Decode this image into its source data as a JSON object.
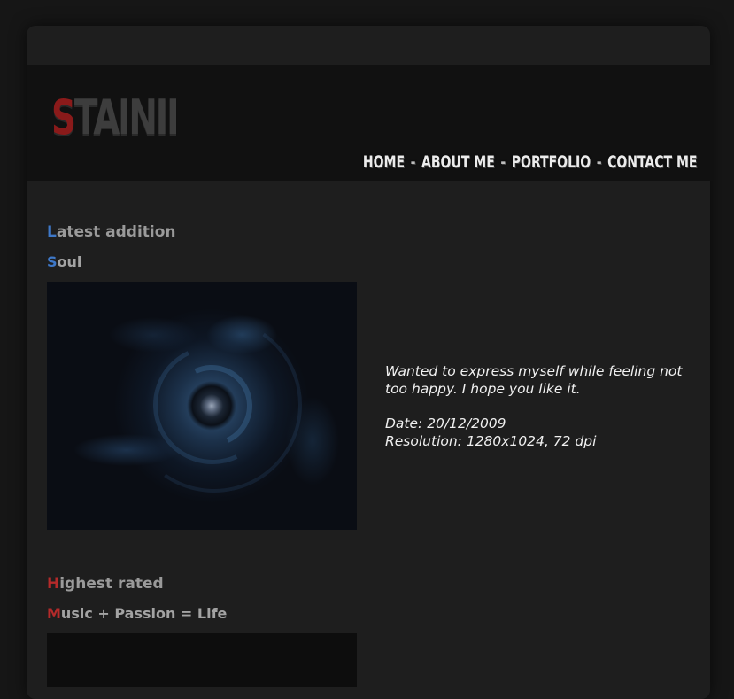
{
  "header": {
    "logo_first_letter": "S",
    "logo_rest": "TAINII",
    "nav": [
      {
        "label": "HOME"
      },
      {
        "label": "ABOUT ME"
      },
      {
        "label": "PORTFOLIO"
      },
      {
        "label": "CONTACT ME"
      }
    ],
    "nav_separator": "-"
  },
  "latest": {
    "heading_first": "L",
    "heading_rest": "atest addition",
    "item_first": "S",
    "item_rest": "oul",
    "description": "Wanted to express myself while feeling not too happy. I hope you like it.",
    "date": "Date: 20/12/2009",
    "resolution": "Resolution: 1280x1024, 72 dpi"
  },
  "highest": {
    "heading_first": "H",
    "heading_rest": "ighest rated",
    "item_first": "M",
    "item_rest": "usic + Passion = Life"
  },
  "colors": {
    "accent_blue": "#3e78c8",
    "accent_red": "#b42a2a",
    "logo_red": "#8a1a1a"
  }
}
